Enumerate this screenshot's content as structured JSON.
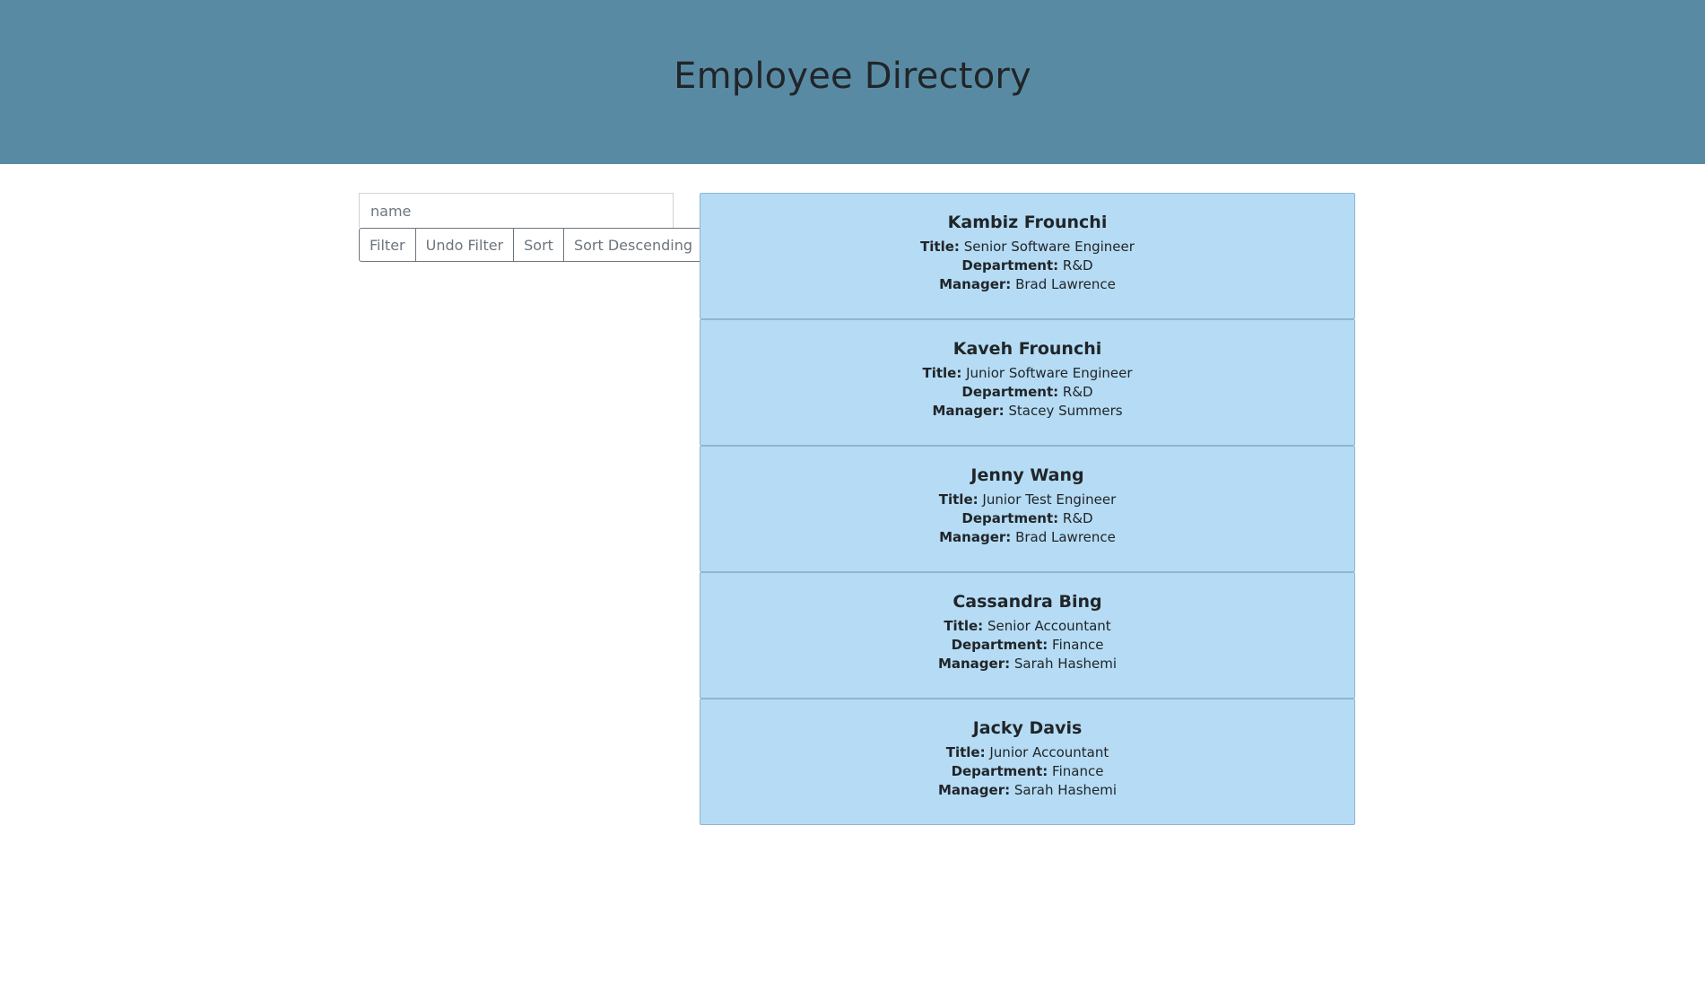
{
  "header": {
    "title": "Employee Directory"
  },
  "controls": {
    "search_placeholder": "name",
    "search_value": "",
    "filter_label": "Filter",
    "undo_filter_label": "Undo Filter",
    "sort_label": "Sort",
    "sort_descending_label": "Sort Descending"
  },
  "labels": {
    "title": "Title:",
    "department": "Department:",
    "manager": "Manager:"
  },
  "employees": [
    {
      "name": "Kambiz Frounchi",
      "title": "Senior Software Engineer",
      "department": "R&D",
      "manager": "Brad Lawrence"
    },
    {
      "name": "Kaveh Frounchi",
      "title": "Junior Software Engineer",
      "department": "R&D",
      "manager": "Stacey Summers"
    },
    {
      "name": "Jenny Wang",
      "title": "Junior Test Engineer",
      "department": "R&D",
      "manager": "Brad Lawrence"
    },
    {
      "name": "Cassandra Bing",
      "title": "Senior Accountant",
      "department": "Finance",
      "manager": "Sarah Hashemi"
    },
    {
      "name": "Jacky Davis",
      "title": "Junior Accountant",
      "department": "Finance",
      "manager": "Sarah Hashemi"
    }
  ],
  "colors": {
    "header_bg": "#588ba3",
    "card_bg": "#b5dcf4",
    "card_border": "#8fb5d0"
  }
}
